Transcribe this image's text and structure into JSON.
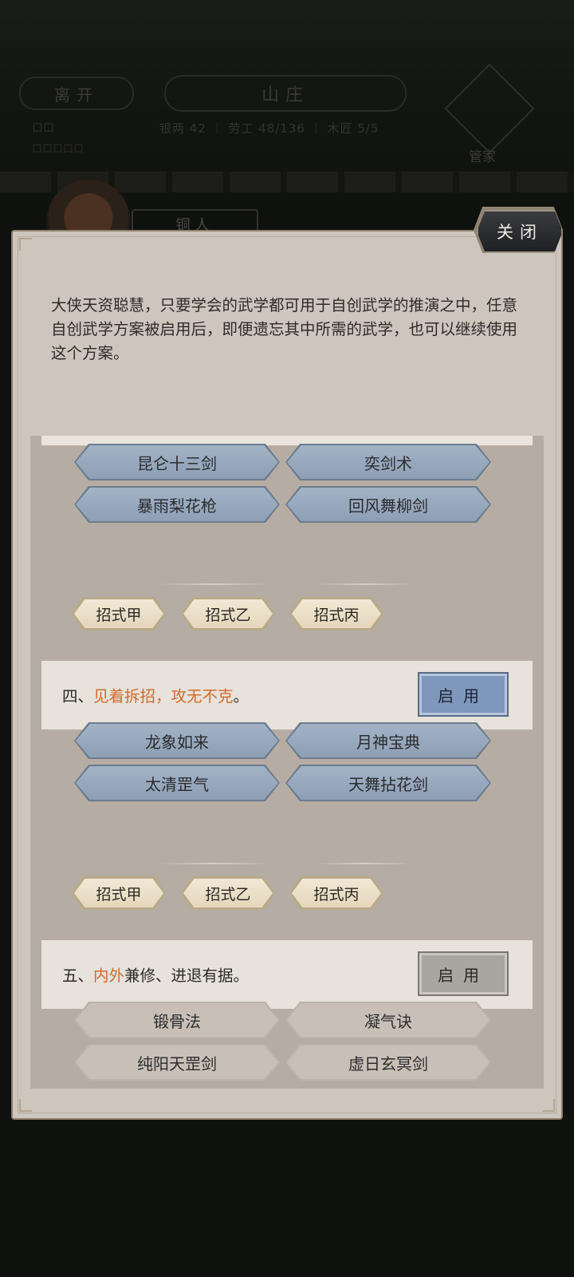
{
  "background": {
    "leave_label": "离开",
    "location_title": "山庄",
    "stats_text": "银两 42 ｜ 劳工 48/136 ｜ 木匠 5/5",
    "left_text_1": "口口",
    "left_text_2": "口口口口口",
    "manager_label": "管家",
    "character_name": "铜人"
  },
  "modal": {
    "close_label": "关闭",
    "description": "大侠天资聪慧，只要学会的武学都可用于自创武学的推演之中，任意自创武学方案被启用后，即便遗忘其中所需的武学，也可以继续使用这个方案。"
  },
  "top_group": {
    "skills": [
      "昆仑十三剑",
      "奕剑术",
      "暴雨梨花枪",
      "回风舞柳剑"
    ],
    "moves": [
      "招式甲",
      "招式乙",
      "招式丙"
    ]
  },
  "schemes": [
    {
      "prefix": "四、",
      "highlight": "见着拆招，攻无不克",
      "suffix": "。",
      "button_label": "启用",
      "button_state": "active",
      "skills": [
        "龙象如来",
        "月神宝典",
        "太清罡气",
        "天舞拈花剑"
      ],
      "moves": [
        "招式甲",
        "招式乙",
        "招式丙"
      ]
    },
    {
      "prefix": "五、",
      "highlight": "内外",
      "suffix": "兼修、进退有据。",
      "button_label": "启用",
      "button_state": "inactive",
      "skills": [
        "锻骨法",
        "凝气诀",
        "纯阳天罡剑",
        "虚日玄冥剑"
      ]
    }
  ],
  "colors": {
    "highlight": "#d36a2c",
    "enable_active": "#7f97bd",
    "enable_inactive": "#a9a59f",
    "skill_blue": "#a3b3c6"
  }
}
